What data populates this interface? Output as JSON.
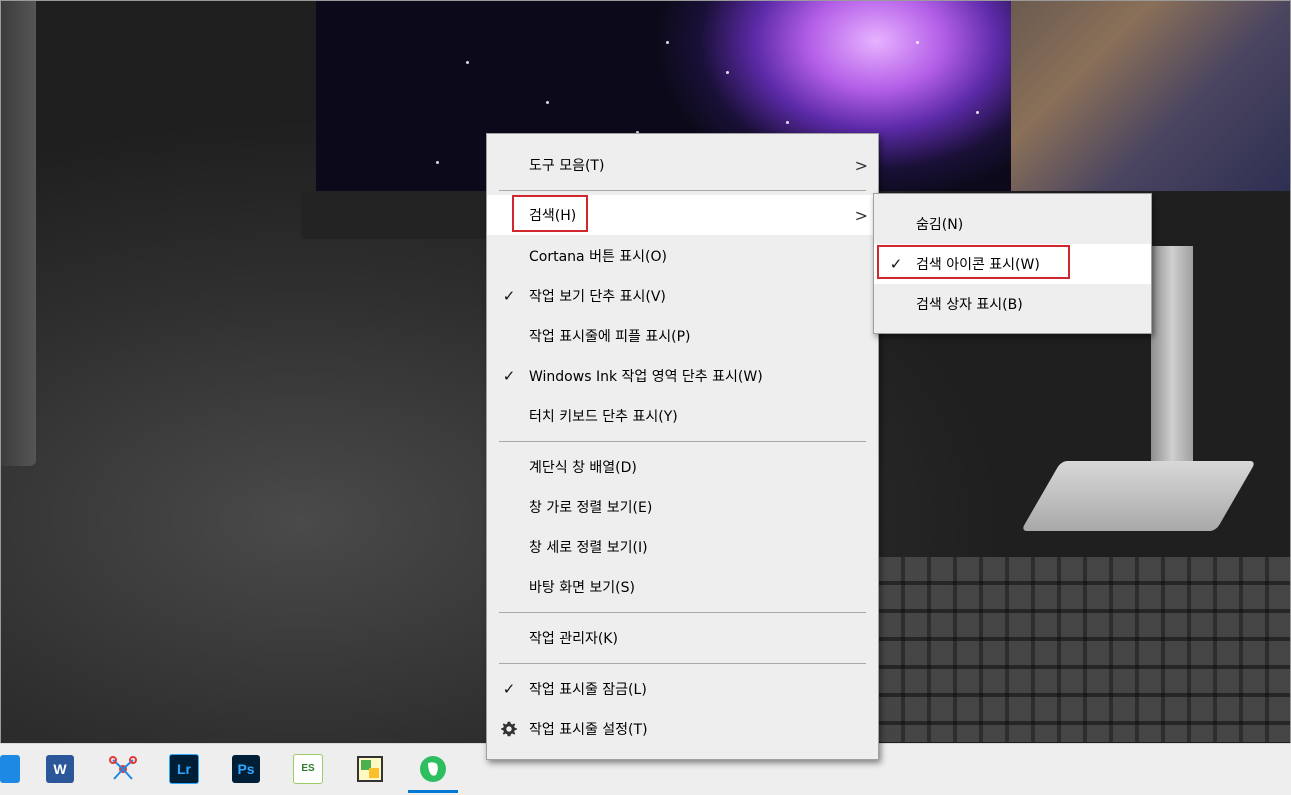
{
  "main_menu": {
    "toolbars": "도구 모음(T)",
    "search": "검색(H)",
    "cortana": "Cortana 버튼 표시(O)",
    "task_view": "작업 보기 단추 표시(V)",
    "people": "작업 표시줄에 피플 표시(P)",
    "windows_ink": "Windows Ink 작업 영역 단추 표시(W)",
    "touch_keyboard": "터치 키보드 단추 표시(Y)",
    "cascade": "계단식 창 배열(D)",
    "stacked": "창 가로 정렬 보기(E)",
    "side_by_side": "창 세로 정렬 보기(I)",
    "show_desktop": "바탕 화면 보기(S)",
    "task_manager": "작업 관리자(K)",
    "lock_taskbar": "작업 표시줄 잠금(L)",
    "taskbar_settings": "작업 표시줄 설정(T)"
  },
  "search_submenu": {
    "hidden": "숨김(N)",
    "show_icon": "검색 아이콘 표시(W)",
    "show_box": "검색 상자 표시(B)"
  },
  "checked_items": [
    "task_view",
    "windows_ink",
    "lock_taskbar",
    "show_icon"
  ],
  "taskbar": {
    "apps": [
      {
        "name": "word",
        "letter": "W",
        "color": "#2b579a"
      },
      {
        "name": "mindmap",
        "letter": "",
        "color": "#ffffff"
      },
      {
        "name": "lightroom",
        "letter": "Lr",
        "color": "#001e36"
      },
      {
        "name": "photoshop",
        "letter": "Ps",
        "color": "#001e36"
      },
      {
        "name": "es-explorer",
        "letter": "ES",
        "color": "#ffffff"
      },
      {
        "name": "notepad",
        "letter": "",
        "color": "#ffffff"
      },
      {
        "name": "evernote",
        "letter": "",
        "color": "#2dbe60"
      }
    ]
  },
  "colors": {
    "highlight_box": "#d1282f",
    "menu_bg": "#eeeeee",
    "taskbar_accent": "#0078d4"
  }
}
